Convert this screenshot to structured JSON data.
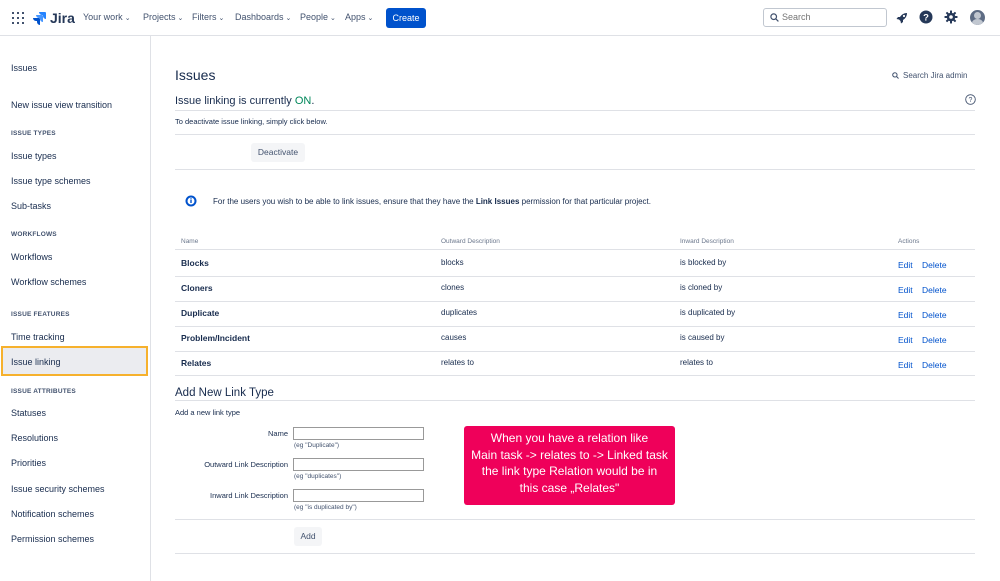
{
  "topnav": {
    "logo": "Jira",
    "menu": [
      {
        "label": "Your work"
      },
      {
        "label": "Projects"
      },
      {
        "label": "Filters"
      },
      {
        "label": "Dashboards"
      },
      {
        "label": "People"
      },
      {
        "label": "Apps"
      }
    ],
    "create_label": "Create",
    "search_placeholder": "Search",
    "accent": "#0052cc"
  },
  "sidebar": {
    "title": "Issues",
    "transition": "New issue view transition",
    "sections": [
      {
        "heading": "ISSUE TYPES",
        "items": [
          "Issue types",
          "Issue type schemes",
          "Sub-tasks"
        ]
      },
      {
        "heading": "WORKFLOWS",
        "items": [
          "Workflows",
          "Workflow schemes"
        ]
      },
      {
        "heading": "ISSUE FEATURES",
        "items": [
          "Time tracking",
          "Issue linking"
        ]
      },
      {
        "heading": "ISSUE ATTRIBUTES",
        "items": [
          "Statuses",
          "Resolutions",
          "Priorities",
          "Issue security schemes",
          "Notification schemes",
          "Permission schemes"
        ]
      }
    ],
    "active_item": "Issue linking",
    "highlight_color": "#f6b12d"
  },
  "main": {
    "title": "Issues",
    "search_admin": "Search Jira admin",
    "status_prefix": "Issue linking is currently ",
    "status_value": "ON",
    "status_suffix": ".",
    "status_color": "#00875a",
    "deactivate_hint": "To deactivate issue linking, simply click below.",
    "deactivate_label": "Deactivate",
    "info_before": "For the users you wish to be able to link issues, ensure that they have the ",
    "info_bold": "Link Issues",
    "info_after": " permission for that particular project.",
    "table": {
      "headers": [
        "Name",
        "Outward Description",
        "Inward Description",
        "Actions"
      ],
      "rows": [
        {
          "name": "Blocks",
          "outward": "blocks",
          "inward": "is blocked by"
        },
        {
          "name": "Cloners",
          "outward": "clones",
          "inward": "is cloned by"
        },
        {
          "name": "Duplicate",
          "outward": "duplicates",
          "inward": "is duplicated by"
        },
        {
          "name": "Problem/Incident",
          "outward": "causes",
          "inward": "is caused by"
        },
        {
          "name": "Relates",
          "outward": "relates to",
          "inward": "relates to"
        }
      ],
      "edit_label": "Edit",
      "delete_label": "Delete"
    },
    "add_form": {
      "title": "Add New Link Type",
      "subtitle": "Add a new link type",
      "fields": [
        {
          "label": "Name",
          "value": "",
          "hint": "(eg \"Duplicate\")"
        },
        {
          "label": "Outward Link Description",
          "value": "",
          "hint": "(eg \"duplicates\")"
        },
        {
          "label": "Inward Link Description",
          "value": "",
          "hint": "(eg \"is duplicated by\")"
        }
      ],
      "add_label": "Add"
    },
    "callout": {
      "lines": [
        "When you have a relation like",
        "Main task -> relates to -> Linked task",
        "the link type Relation would be in",
        "this case „Relates\""
      ],
      "color": "#ef005a"
    }
  }
}
